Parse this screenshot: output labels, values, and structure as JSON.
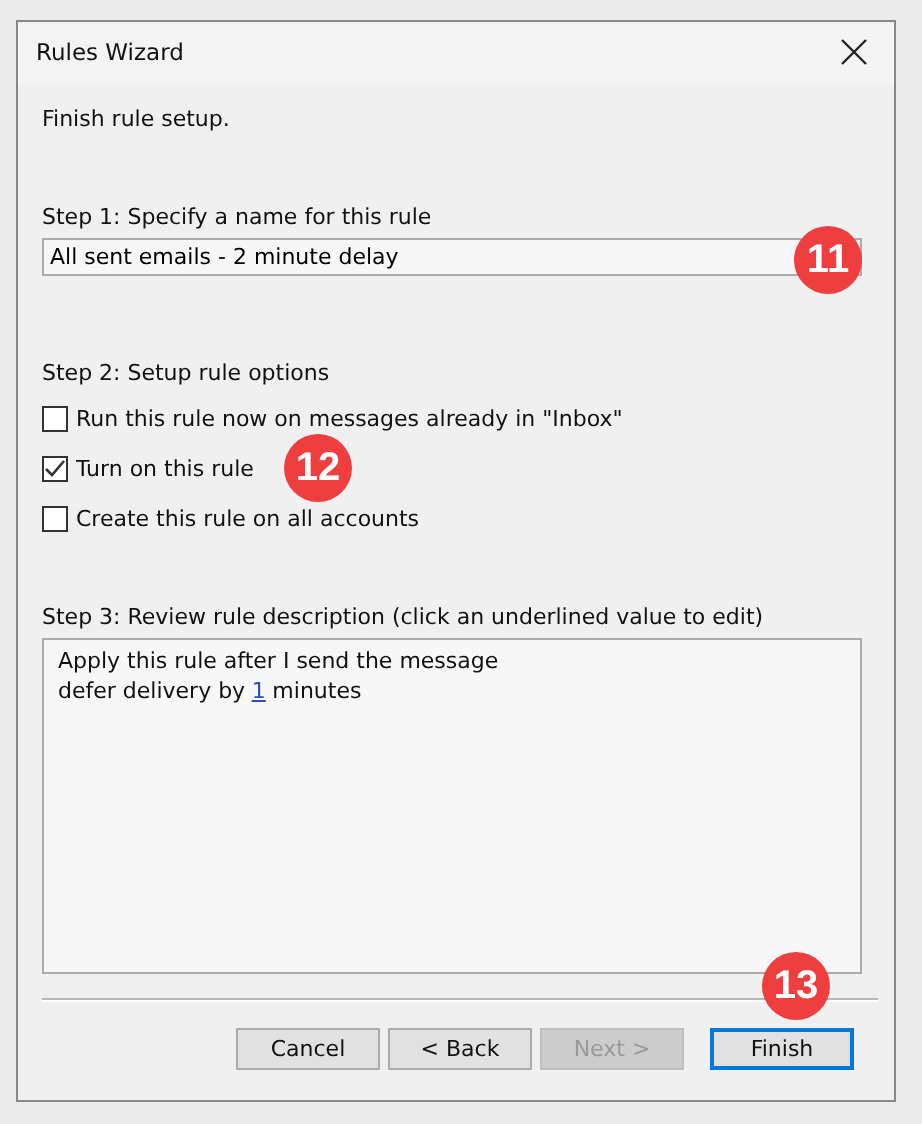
{
  "window": {
    "title": "Rules Wizard"
  },
  "heading": "Finish rule setup.",
  "step1": {
    "label": "Step 1: Specify a name for this rule",
    "value": "All sent emails - 2 minute delay"
  },
  "step2": {
    "label": "Step 2: Setup rule options",
    "options": [
      {
        "label": "Run this rule now on messages already in \"Inbox\"",
        "checked": false
      },
      {
        "label": "Turn on this rule",
        "checked": true
      },
      {
        "label": "Create this rule on all accounts",
        "checked": false
      }
    ]
  },
  "step3": {
    "label": "Step 3: Review rule description (click an underlined value to edit)",
    "lines": [
      {
        "parts": [
          {
            "text": "Apply this rule after I send the message",
            "kind": "plain"
          }
        ]
      },
      {
        "parts": [
          {
            "text": "defer delivery by",
            "kind": "plain"
          },
          {
            "text": "1",
            "kind": "link"
          },
          {
            "text": "minutes",
            "kind": "plain"
          }
        ]
      }
    ]
  },
  "buttons": [
    {
      "label": "Cancel",
      "disabled": false,
      "selected": false
    },
    {
      "label": "< Back",
      "disabled": false,
      "selected": false
    },
    {
      "label": "Next >",
      "disabled": true,
      "selected": false
    },
    {
      "label": "Finish",
      "disabled": false,
      "selected": true
    }
  ],
  "badges": [
    {
      "text": "11",
      "kind": "name"
    },
    {
      "text": "12",
      "kind": "options"
    },
    {
      "text": "13",
      "kind": "finish"
    }
  ]
}
